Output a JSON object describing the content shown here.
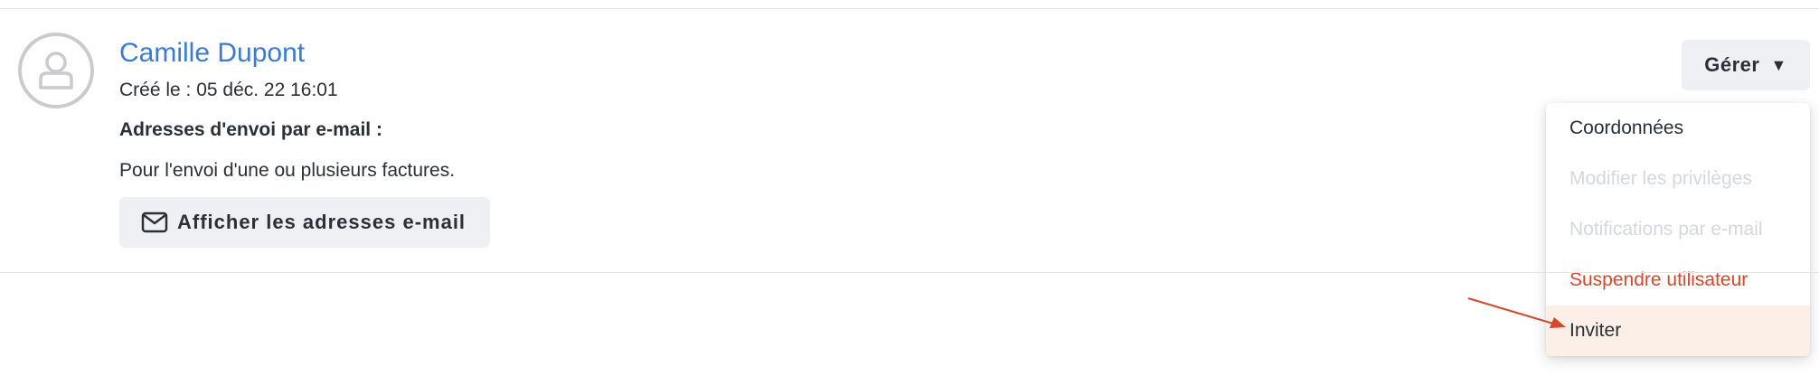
{
  "user": {
    "name": "Camille Dupont",
    "created": "Créé le : 05 déc. 22 16:01",
    "email_heading": "Adresses d'envoi par e-mail :",
    "email_description": "Pour l'envoi d'une ou plusieurs factures.",
    "show_emails_label": "Afficher les adresses e-mail",
    "avatar_icon": "user-placeholder-icon"
  },
  "manage": {
    "label": "Gérer",
    "caret": "▼",
    "menu": [
      {
        "label": "Coordonnées",
        "state": "normal"
      },
      {
        "label": "Modifier les privilèges",
        "state": "disabled"
      },
      {
        "label": "Notifications par e-mail",
        "state": "disabled"
      },
      {
        "label": "Suspendre utilisateur",
        "state": "danger"
      },
      {
        "label": "Inviter",
        "state": "highlighted"
      }
    ]
  },
  "colors": {
    "link": "#3a7bd5",
    "danger": "#d5482b",
    "highlight_bg": "#fcefe8",
    "button_bg": "#eef0f3",
    "annotation_arrow": "#d5482b"
  }
}
